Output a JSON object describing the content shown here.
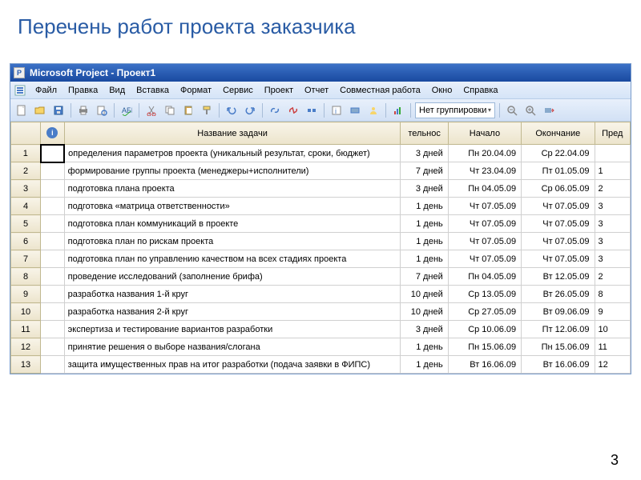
{
  "slide": {
    "title": "Перечень работ проекта заказчика",
    "page_number": "3"
  },
  "app": {
    "title": "Microsoft Project - Проект1",
    "menu": [
      "Файл",
      "Правка",
      "Вид",
      "Вставка",
      "Формат",
      "Сервис",
      "Проект",
      "Отчет",
      "Совместная работа",
      "Окно",
      "Справка"
    ],
    "grouping_dropdown": "Нет группировки"
  },
  "columns": {
    "id": "",
    "info": "",
    "name": "Название задачи",
    "duration": "тельнос",
    "start": "Начало",
    "end": "Окончание",
    "pred": "Пред"
  },
  "rows": [
    {
      "n": "1",
      "name": "определения параметров проекта (уникальный результат, сроки, бюджет)",
      "dur": "3 дней",
      "start": "Пн 20.04.09",
      "end": "Ср 22.04.09",
      "pred": ""
    },
    {
      "n": "2",
      "name": "формирование группы проекта (менеджеры+исполнители)",
      "dur": "7 дней",
      "start": "Чт 23.04.09",
      "end": "Пт 01.05.09",
      "pred": "1"
    },
    {
      "n": "3",
      "name": "подготовка плана проекта",
      "dur": "3 дней",
      "start": "Пн 04.05.09",
      "end": "Ср 06.05.09",
      "pred": "2"
    },
    {
      "n": "4",
      "name": "подготовка «матрица ответственности»",
      "dur": "1 день",
      "start": "Чт 07.05.09",
      "end": "Чт 07.05.09",
      "pred": "3"
    },
    {
      "n": "5",
      "name": "подготовка  план коммуникаций в проекте",
      "dur": "1 день",
      "start": "Чт 07.05.09",
      "end": "Чт 07.05.09",
      "pred": "3"
    },
    {
      "n": "6",
      "name": "подготовка план по рискам проекта",
      "dur": "1 день",
      "start": "Чт 07.05.09",
      "end": "Чт 07.05.09",
      "pred": "3"
    },
    {
      "n": "7",
      "name": "подготовка план по управлению качеством на всех стадиях проекта",
      "dur": "1 день",
      "start": "Чт 07.05.09",
      "end": "Чт 07.05.09",
      "pred": "3"
    },
    {
      "n": "8",
      "name": "проведение исследований (заполнение брифа)",
      "dur": "7 дней",
      "start": "Пн 04.05.09",
      "end": "Вт 12.05.09",
      "pred": "2"
    },
    {
      "n": "9",
      "name": "разработка названия 1-й круг",
      "dur": "10 дней",
      "start": "Ср 13.05.09",
      "end": "Вт 26.05.09",
      "pred": "8"
    },
    {
      "n": "10",
      "name": "разработка названия  2-й круг",
      "dur": "10 дней",
      "start": "Ср 27.05.09",
      "end": "Вт 09.06.09",
      "pred": "9"
    },
    {
      "n": "11",
      "name": "экспертиза и тестирование вариантов разработки",
      "dur": "3 дней",
      "start": "Ср 10.06.09",
      "end": "Пт 12.06.09",
      "pred": "10"
    },
    {
      "n": "12",
      "name": "принятие решения о выборе названия/слогана",
      "dur": "1 день",
      "start": "Пн 15.06.09",
      "end": "Пн 15.06.09",
      "pred": "11"
    },
    {
      "n": "13",
      "name": "защита имущественных прав на итог разработки (подача заявки в ФИПС)",
      "dur": "1 день",
      "start": "Вт 16.06.09",
      "end": "Вт 16.06.09",
      "pred": "12"
    }
  ]
}
